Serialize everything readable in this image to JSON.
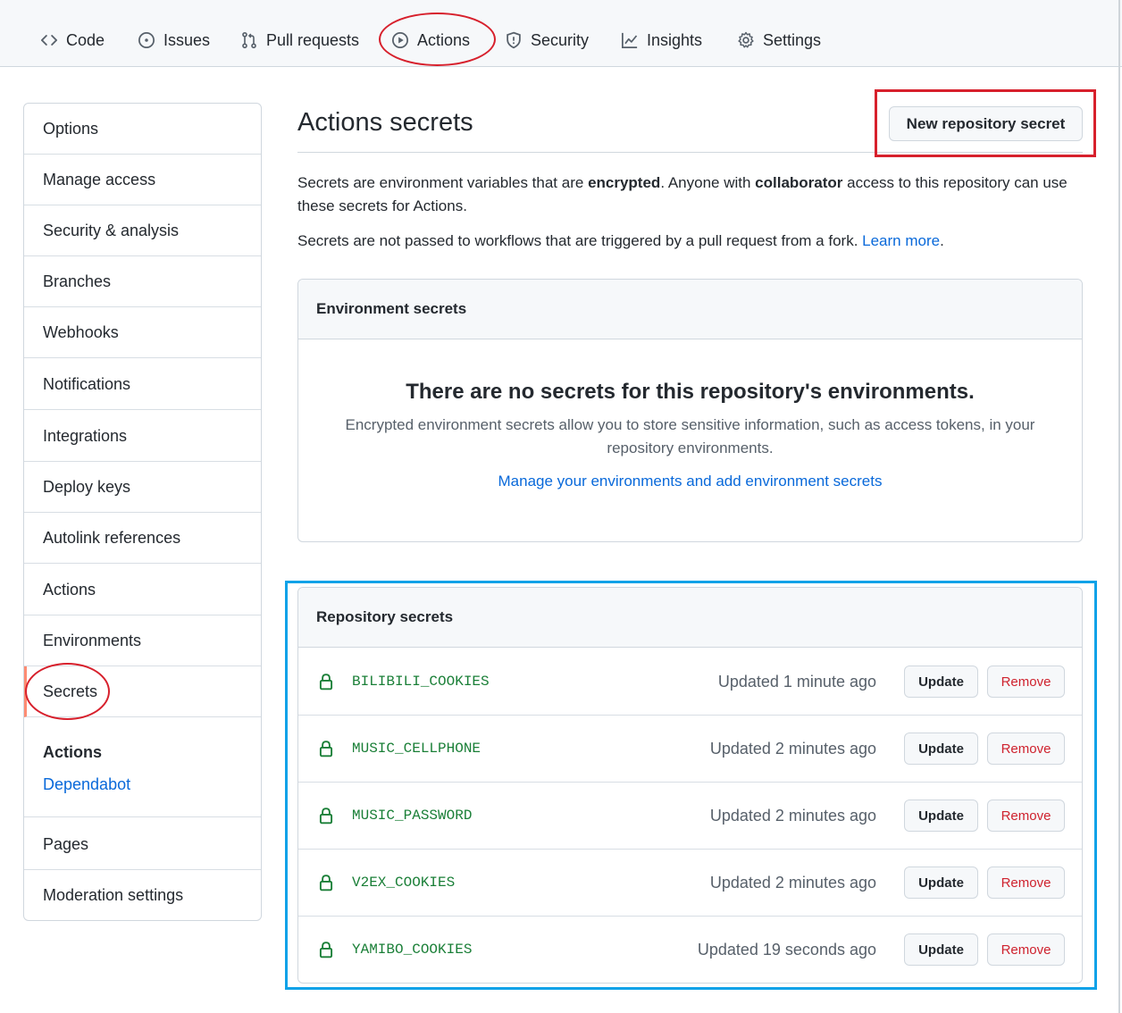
{
  "topnav": {
    "tabs": [
      {
        "label": "Code",
        "icon": "code-icon"
      },
      {
        "label": "Issues",
        "icon": "issue-opened-icon"
      },
      {
        "label": "Pull requests",
        "icon": "git-pull-request-icon"
      },
      {
        "label": "Actions",
        "icon": "play-icon"
      },
      {
        "label": "Security",
        "icon": "shield-icon"
      },
      {
        "label": "Insights",
        "icon": "graph-icon"
      },
      {
        "label": "Settings",
        "icon": "gear-icon"
      }
    ]
  },
  "sidebar": {
    "items": [
      {
        "label": "Options"
      },
      {
        "label": "Manage access"
      },
      {
        "label": "Security & analysis"
      },
      {
        "label": "Branches"
      },
      {
        "label": "Webhooks"
      },
      {
        "label": "Notifications"
      },
      {
        "label": "Integrations"
      },
      {
        "label": "Deploy keys"
      },
      {
        "label": "Autolink references"
      },
      {
        "label": "Actions"
      },
      {
        "label": "Environments"
      },
      {
        "label": "Secrets",
        "selected": true
      }
    ],
    "sub_heading": "Actions",
    "sub_link": "Dependabot",
    "bottom_items": [
      {
        "label": "Pages"
      },
      {
        "label": "Moderation settings"
      }
    ]
  },
  "main": {
    "title": "Actions secrets",
    "new_secret_button": "New repository secret",
    "desc1": {
      "part1": "Secrets are environment variables that are ",
      "bold1": "encrypted",
      "part2": ". Anyone with ",
      "bold2": "collaborator",
      "part3": " access to this repository can use these secrets for Actions."
    },
    "desc2": {
      "text": "Secrets are not passed to workflows that are triggered by a pull request from a fork. ",
      "link": "Learn more",
      "end": "."
    },
    "environment_secrets": {
      "header": "Environment secrets",
      "empty_title": "There are no secrets for this repository's environments.",
      "empty_desc": "Encrypted environment secrets allow you to store sensitive information, such as access tokens, in your repository environments.",
      "link": "Manage your environments and add environment secrets"
    },
    "repository_secrets": {
      "header": "Repository secrets",
      "update_label": "Update",
      "remove_label": "Remove",
      "rows": [
        {
          "name": "BILIBILI_COOKIES",
          "updated": "Updated 1 minute ago"
        },
        {
          "name": "MUSIC_CELLPHONE",
          "updated": "Updated 2 minutes ago"
        },
        {
          "name": "MUSIC_PASSWORD",
          "updated": "Updated 2 minutes ago"
        },
        {
          "name": "V2EX_COOKIES",
          "updated": "Updated 2 minutes ago"
        },
        {
          "name": "YAMIBO_COOKIES",
          "updated": "Updated 19 seconds ago"
        }
      ]
    }
  },
  "colors": {
    "link": "#0969da",
    "secret_name": "#1a7f37",
    "danger": "#cf222e",
    "annotation_red": "#d7202c",
    "annotation_blue": "#0ea2e8",
    "selected_indicator": "#fd8c73"
  }
}
